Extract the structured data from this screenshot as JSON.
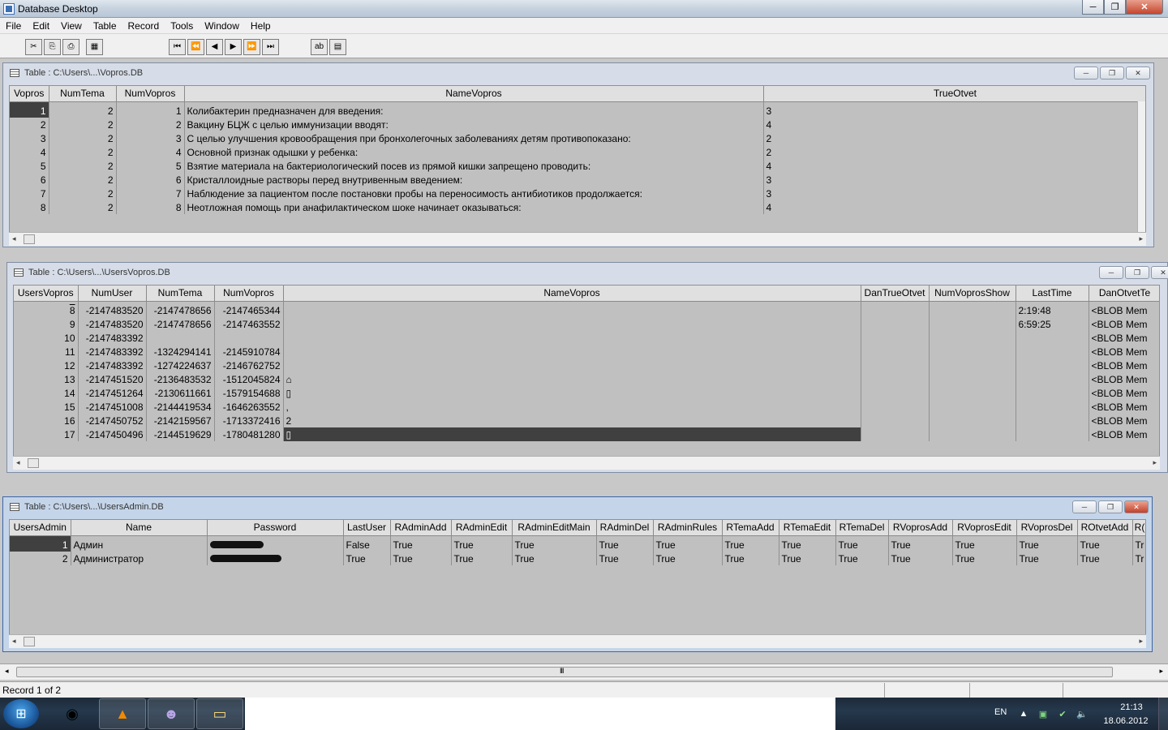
{
  "app": {
    "title": "Database Desktop",
    "minimize": "─",
    "maximize": "❐",
    "close": "✕"
  },
  "menu": [
    "File",
    "Edit",
    "View",
    "Table",
    "Record",
    "Tools",
    "Window",
    "Help"
  ],
  "toolbar": {
    "cut": "✂",
    "copy": "⎘",
    "paste": "⎙",
    "table_view": "▦",
    "first": "⏮",
    "prev_set": "⏪",
    "prev": "◀",
    "next": "▶",
    "next_set": "⏩",
    "last": "⏭",
    "edit_field": "ab",
    "edit_data": "▤"
  },
  "windows": {
    "vopros": {
      "title": "Table : C:\\Users\\...\\Vopros.DB",
      "columns": [
        "Vopros",
        "NumTema",
        "NumVopros",
        "NameVopros",
        "TrueOtvet"
      ],
      "rows": [
        [
          "1",
          "2",
          "1",
          "Колибактерин предназначен для введения:",
          "3"
        ],
        [
          "2",
          "2",
          "2",
          "Вакцину БЦЖ с целью иммунизации вводят:",
          "4"
        ],
        [
          "3",
          "2",
          "3",
          "С целью улучшения кровообращения при бронхолегочных заболеваниях детям противопоказано:",
          "2"
        ],
        [
          "4",
          "2",
          "4",
          "Основной признак одышки у ребенка:",
          "2"
        ],
        [
          "5",
          "2",
          "5",
          "Взятие материала на бактериологический посев из прямой кишки  запрещено проводить:",
          "4"
        ],
        [
          "6",
          "2",
          "6",
          "Кристаллоидные растворы  перед внутривенным введением:",
          "3"
        ],
        [
          "7",
          "2",
          "7",
          "Наблюдение  за пациентом после постановки пробы на переносимость антибиотиков продолжается:",
          "3"
        ],
        [
          "8",
          "2",
          "8",
          "Неотложная помощь при анафилактическом шоке начинает  оказываться:",
          "4"
        ]
      ]
    },
    "usersvopros": {
      "title": "Table : C:\\Users\\...\\UsersVopros.DB",
      "columns": [
        "UsersVopros",
        "NumUser",
        "NumTema",
        "NumVopros",
        "NameVopros",
        "DanTrueOtvet",
        "NumVoprosShow",
        "LastTime",
        "DanOtvetTe"
      ],
      "rows": [
        [
          "8",
          "-2147483520",
          "-2147478656",
          "-2147465344",
          "",
          "",
          "",
          "2:19:48",
          "<BLOB Mem"
        ],
        [
          "9",
          "-2147483520",
          "-2147478656",
          "-2147463552",
          "",
          "",
          "",
          "6:59:25",
          "<BLOB Mem"
        ],
        [
          "10",
          "-2147483392",
          "",
          "",
          "",
          "",
          "",
          "",
          "<BLOB Mem"
        ],
        [
          "11",
          "-2147483392",
          "-1324294141",
          "-2145910784",
          "",
          "",
          "",
          "",
          "<BLOB Mem"
        ],
        [
          "12",
          "-2147483392",
          "-1274224637",
          "-2146762752",
          "",
          "",
          "",
          "",
          "<BLOB Mem"
        ],
        [
          "13",
          "-2147451520",
          "-2136483532",
          "-1512045824",
          "⌂",
          "",
          "",
          "",
          "<BLOB Mem"
        ],
        [
          "14",
          "-2147451264",
          "-2130611661",
          "-1579154688",
          "▯",
          "",
          "",
          "",
          "<BLOB Mem"
        ],
        [
          "15",
          "-2147451008",
          "-2144419534",
          "-1646263552",
          ",",
          "",
          "",
          "",
          "<BLOB Mem"
        ],
        [
          "16",
          "-2147450752",
          "-2142159567",
          "-1713372416",
          "2",
          "",
          "",
          "",
          "<BLOB Mem"
        ],
        [
          "17",
          "-2147450496",
          "-2144519629",
          "-1780481280",
          "▯",
          "",
          "",
          "",
          "<BLOB Mem"
        ]
      ]
    },
    "usersadmin": {
      "title": "Table : C:\\Users\\...\\UsersAdmin.DB",
      "columns": [
        "UsersAdmin",
        "Name",
        "Password",
        "LastUser",
        "RAdminAdd",
        "RAdminEdit",
        "RAdminEditMain",
        "RAdminDel",
        "RAdminRules",
        "RTemaAdd",
        "RTemaEdit",
        "RTemaDel",
        "RVoprosAdd",
        "RVoprosEdit",
        "RVoprosDel",
        "ROtvetAdd",
        "R("
      ],
      "rows": [
        [
          "1",
          "Админ",
          "",
          "False",
          "True",
          "True",
          "True",
          "True",
          "True",
          "True",
          "True",
          "True",
          "True",
          "True",
          "True",
          "True",
          "Tr"
        ],
        [
          "2",
          "Администратор",
          "",
          "True",
          "True",
          "True",
          "True",
          "True",
          "True",
          "True",
          "True",
          "True",
          "True",
          "True",
          "True",
          "True",
          "Tr"
        ]
      ]
    }
  },
  "mdi_scroll_grip": "III",
  "status": {
    "record": "Record 1 of 2"
  },
  "taskbar": {
    "start": "⊞",
    "apps": [
      {
        "name": "chrome",
        "glyph": "◉"
      },
      {
        "name": "vlc",
        "glyph": "▲"
      },
      {
        "name": "pidgin",
        "glyph": "☻"
      },
      {
        "name": "explorer",
        "glyph": "▭"
      }
    ],
    "lang": "EN",
    "time": "21:13",
    "date": "18.06.2012"
  }
}
